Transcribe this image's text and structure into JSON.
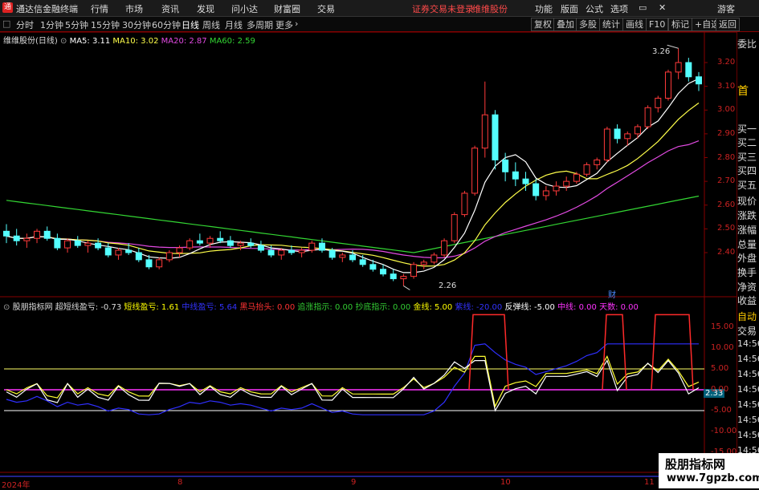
{
  "titlebar": {
    "app_name": "通达信金融终端",
    "menu": [
      "行情",
      "市场",
      "资讯",
      "发现",
      "问小达",
      "财富圈",
      "交易"
    ],
    "warning": "证券交易未登录",
    "stock_name": "维维股份",
    "right_menu": [
      "功能",
      "版面",
      "公式",
      "选项"
    ],
    "guest": "游客"
  },
  "tabs": {
    "items": [
      "分时",
      "1分钟",
      "5分钟",
      "15分钟",
      "30分钟",
      "60分钟",
      "日线",
      "周线",
      "月线",
      "多周期",
      "更多"
    ],
    "active": "日线",
    "right_buttons": [
      "复权",
      "叠加",
      "多股",
      "统计",
      "画线",
      "F10",
      "标记",
      "+自选",
      "返回"
    ]
  },
  "main_legend": {
    "title": "维维股份(日线)",
    "items": [
      {
        "label": "MA5: 3.11",
        "color": "#ffffff"
      },
      {
        "label": "MA10: 3.02",
        "color": "#ffff4a"
      },
      {
        "label": "MA20: 2.87",
        "color": "#e24ae2"
      },
      {
        "label": "MA60: 2.59",
        "color": "#33d633"
      }
    ]
  },
  "indicator_legend": {
    "title": "股朋指标网",
    "items": [
      {
        "label": "超短线盈亏: -0.73",
        "color": "#dddddd"
      },
      {
        "label": "短线盈亏: 1.61",
        "color": "#ffff00"
      },
      {
        "label": "中线盈亏: 5.64",
        "color": "#3333ff"
      },
      {
        "label": "黑马抬头: 0.00",
        "color": "#ff3333"
      },
      {
        "label": "追涨指示: 0.00",
        "color": "#33cc33"
      },
      {
        "label": "抄底指示: 0.00",
        "color": "#33cc33"
      },
      {
        "label": "金线: 5.00",
        "color": "#ffff00"
      },
      {
        "label": "紫线: -20.00",
        "color": "#3333ff"
      },
      {
        "label": "反弹线: -5.00",
        "color": "#ffffff"
      },
      {
        "label": "中线: 0.00",
        "color": "#ff33ff"
      },
      {
        "label": "天数: 0.00",
        "color": "#ff33ff"
      }
    ]
  },
  "price_axis": [
    "3.20",
    "3.10",
    "3.00",
    "2.90",
    "2.80",
    "2.70",
    "2.60",
    "2.50",
    "2.40"
  ],
  "indicator_axis": [
    "15.00",
    "10.00",
    "5.00",
    "0.00",
    "-5.00",
    "-10.00",
    "-15.00"
  ],
  "annotations": {
    "high": "3.26",
    "low": "2.26",
    "cai": "财",
    "current_value": "2.33"
  },
  "date_axis": [
    "2024年",
    "8",
    "9",
    "10",
    "11"
  ],
  "side_panel": {
    "labels": [
      "委比",
      "首",
      "买一",
      "买二",
      "买三",
      "买四",
      "买五",
      "现价",
      "涨跌",
      "涨幅",
      "总量",
      "外盘",
      "换手",
      "净资",
      "收益",
      "自动",
      "交易"
    ],
    "times": [
      "14:56",
      "14:56",
      "14:56",
      "14:56",
      "14:56",
      "14:56",
      "14:56",
      "14:56"
    ]
  },
  "watermark": {
    "line1": "股朋指标网",
    "line2": "www.7gpzb.com"
  },
  "chart_data": {
    "type": "candlestick",
    "ylim": [
      2.2,
      3.3
    ],
    "ohlc": [
      [
        2.49,
        2.52,
        2.44,
        2.47
      ],
      [
        2.47,
        2.5,
        2.43,
        2.45
      ],
      [
        2.45,
        2.48,
        2.42,
        2.46
      ],
      [
        2.46,
        2.5,
        2.44,
        2.49
      ],
      [
        2.49,
        2.51,
        2.45,
        2.46
      ],
      [
        2.46,
        2.48,
        2.41,
        2.42
      ],
      [
        2.42,
        2.46,
        2.4,
        2.45
      ],
      [
        2.45,
        2.47,
        2.42,
        2.43
      ],
      [
        2.43,
        2.45,
        2.4,
        2.44
      ],
      [
        2.44,
        2.46,
        2.41,
        2.42
      ],
      [
        2.42,
        2.44,
        2.38,
        2.39
      ],
      [
        2.39,
        2.42,
        2.37,
        2.41
      ],
      [
        2.41,
        2.44,
        2.39,
        2.4
      ],
      [
        2.4,
        2.42,
        2.36,
        2.37
      ],
      [
        2.37,
        2.39,
        2.33,
        2.34
      ],
      [
        2.34,
        2.38,
        2.33,
        2.37
      ],
      [
        2.37,
        2.41,
        2.36,
        2.4
      ],
      [
        2.4,
        2.43,
        2.38,
        2.42
      ],
      [
        2.42,
        2.46,
        2.41,
        2.45
      ],
      [
        2.45,
        2.48,
        2.43,
        2.44
      ],
      [
        2.44,
        2.47,
        2.42,
        2.46
      ],
      [
        2.46,
        2.49,
        2.44,
        2.45
      ],
      [
        2.45,
        2.47,
        2.42,
        2.43
      ],
      [
        2.43,
        2.45,
        2.41,
        2.44
      ],
      [
        2.44,
        2.46,
        2.42,
        2.43
      ],
      [
        2.43,
        2.45,
        2.4,
        2.41
      ],
      [
        2.41,
        2.43,
        2.38,
        2.39
      ],
      [
        2.39,
        2.42,
        2.37,
        2.41
      ],
      [
        2.41,
        2.43,
        2.39,
        2.4
      ],
      [
        2.4,
        2.42,
        2.38,
        2.41
      ],
      [
        2.41,
        2.45,
        2.4,
        2.44
      ],
      [
        2.44,
        2.46,
        2.4,
        2.41
      ],
      [
        2.41,
        2.42,
        2.37,
        2.38
      ],
      [
        2.38,
        2.4,
        2.36,
        2.39
      ],
      [
        2.39,
        2.41,
        2.36,
        2.37
      ],
      [
        2.37,
        2.39,
        2.34,
        2.35
      ],
      [
        2.35,
        2.37,
        2.32,
        2.33
      ],
      [
        2.33,
        2.35,
        2.3,
        2.31
      ],
      [
        2.31,
        2.33,
        2.28,
        2.29
      ],
      [
        2.29,
        2.31,
        2.26,
        2.3
      ],
      [
        2.3,
        2.36,
        2.29,
        2.35
      ],
      [
        2.35,
        2.37,
        2.33,
        2.36
      ],
      [
        2.36,
        2.4,
        2.35,
        2.39
      ],
      [
        2.39,
        2.46,
        2.38,
        2.45
      ],
      [
        2.45,
        2.57,
        2.44,
        2.56
      ],
      [
        2.56,
        2.66,
        2.55,
        2.65
      ],
      [
        2.65,
        2.85,
        2.64,
        2.84
      ],
      [
        2.84,
        3.12,
        2.8,
        2.98
      ],
      [
        2.98,
        3.0,
        2.75,
        2.79
      ],
      [
        2.79,
        2.82,
        2.7,
        2.74
      ],
      [
        2.74,
        2.78,
        2.68,
        2.71
      ],
      [
        2.71,
        2.74,
        2.66,
        2.69
      ],
      [
        2.69,
        2.71,
        2.62,
        2.64
      ],
      [
        2.64,
        2.68,
        2.62,
        2.66
      ],
      [
        2.66,
        2.7,
        2.64,
        2.68
      ],
      [
        2.68,
        2.72,
        2.66,
        2.7
      ],
      [
        2.7,
        2.74,
        2.69,
        2.73
      ],
      [
        2.73,
        2.78,
        2.72,
        2.77
      ],
      [
        2.77,
        2.8,
        2.75,
        2.79
      ],
      [
        2.79,
        2.93,
        2.78,
        2.92
      ],
      [
        2.92,
        2.94,
        2.86,
        2.88
      ],
      [
        2.88,
        2.91,
        2.85,
        2.9
      ],
      [
        2.9,
        2.94,
        2.88,
        2.93
      ],
      [
        2.93,
        3.02,
        2.92,
        3.01
      ],
      [
        3.01,
        3.06,
        2.99,
        3.05
      ],
      [
        3.05,
        3.17,
        3.04,
        3.16
      ],
      [
        3.16,
        3.26,
        3.13,
        3.2
      ],
      [
        3.2,
        3.22,
        3.12,
        3.14
      ],
      [
        3.14,
        3.16,
        3.08,
        3.11
      ]
    ]
  }
}
